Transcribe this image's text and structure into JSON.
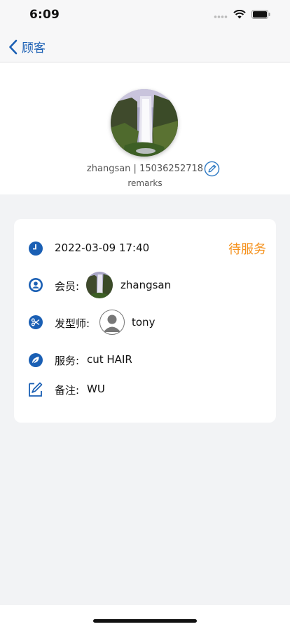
{
  "status_bar": {
    "time": "6:09"
  },
  "nav": {
    "back_label": "顾客"
  },
  "profile": {
    "username": "zhangsan",
    "separator": " | ",
    "phone": "15036252718",
    "remarks": "remarks"
  },
  "appointment": {
    "datetime": "2022-03-09 17:40",
    "status": "待服务",
    "member_label": "会员:",
    "member_name": "zhangsan",
    "stylist_label": "发型师:",
    "stylist_name": "tony",
    "service_label": "服务:",
    "service_value": "cut HAIR",
    "note_label": "备注:",
    "note_value": "WU"
  },
  "colors": {
    "accent": "#1a5fb4",
    "status": "#f5921e",
    "background": "#f2f3f5"
  },
  "icons": [
    "back-chevron-icon",
    "edit-icon",
    "clock-icon",
    "member-icon",
    "scissors-icon",
    "leaf-icon",
    "note-icon"
  ]
}
